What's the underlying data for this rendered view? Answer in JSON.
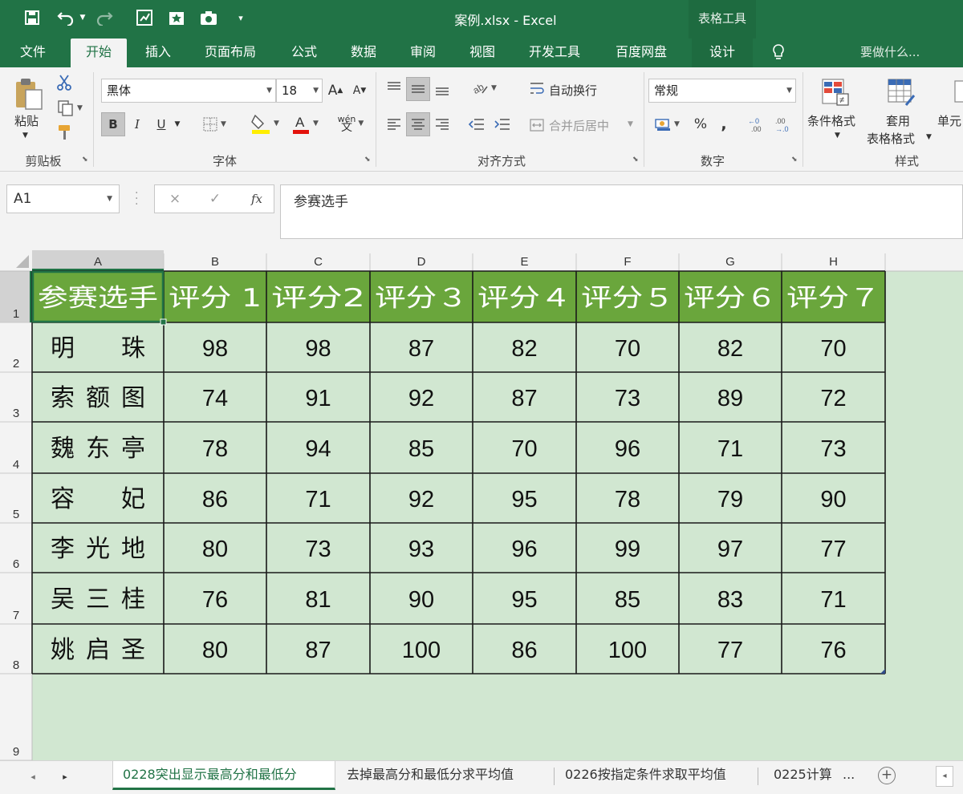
{
  "window": {
    "title": "案例.xlsx - Excel",
    "contextual_title": "表格工具"
  },
  "quick_access": [
    "save-icon",
    "undo-icon",
    "redo-icon",
    "form-icon",
    "star-icon",
    "camera-icon",
    "customize-icon"
  ],
  "ribbon_tabs": [
    {
      "label": "文件"
    },
    {
      "label": "开始"
    },
    {
      "label": "插入"
    },
    {
      "label": "页面布局"
    },
    {
      "label": "公式"
    },
    {
      "label": "数据"
    },
    {
      "label": "审阅"
    },
    {
      "label": "视图"
    },
    {
      "label": "开发工具"
    },
    {
      "label": "百度网盘"
    },
    {
      "label": "设计"
    }
  ],
  "tell_me": "要做什么...",
  "ribbon": {
    "clipboard": {
      "paste_label": "粘贴",
      "group_label": "剪贴板"
    },
    "font": {
      "font_name": "黑体",
      "font_size": "18",
      "bold": "B",
      "italic": "I",
      "underline": "U",
      "group_label": "字体"
    },
    "alignment": {
      "wrap_text": "自动换行",
      "merge_center": "合并后居中",
      "group_label": "对齐方式"
    },
    "number": {
      "format": "常规",
      "percent": "%",
      "comma": ",",
      "group_label": "数字"
    },
    "styles": {
      "conditional": "条件格式",
      "table_format_1": "套用",
      "table_format_2": "表格格式",
      "cell_styles": "单元",
      "group_label": "样式"
    }
  },
  "formula_bar": {
    "name_box": "A1",
    "cancel": "×",
    "enter": "✓",
    "fx": "fx",
    "content": "参赛选手"
  },
  "sheet": {
    "columns": [
      "A",
      "B",
      "C",
      "D",
      "E",
      "F",
      "G",
      "H"
    ],
    "rows": [
      "1",
      "2",
      "3",
      "4",
      "5",
      "6",
      "7",
      "8",
      "9"
    ],
    "header": [
      "参赛选手",
      "评分 1",
      "评分2",
      "评分３",
      "评分４",
      "评分５",
      "评分６",
      "评分７"
    ],
    "data": [
      {
        "name": "明　　珠",
        "scores": [
          "98",
          "98",
          "87",
          "82",
          "70",
          "82",
          "70"
        ]
      },
      {
        "name": "索额图",
        "scores": [
          "74",
          "91",
          "92",
          "87",
          "73",
          "89",
          "72"
        ]
      },
      {
        "name": "魏东亭",
        "scores": [
          "78",
          "94",
          "85",
          "70",
          "96",
          "71",
          "73"
        ]
      },
      {
        "name": "容　　妃",
        "scores": [
          "86",
          "71",
          "92",
          "95",
          "78",
          "79",
          "90"
        ]
      },
      {
        "name": "李光地",
        "scores": [
          "80",
          "73",
          "93",
          "96",
          "99",
          "97",
          "77"
        ]
      },
      {
        "name": "吴三桂",
        "scores": [
          "76",
          "81",
          "90",
          "95",
          "85",
          "83",
          "71"
        ]
      },
      {
        "name": "姚启圣",
        "scores": [
          "80",
          "87",
          "100",
          "86",
          "100",
          "77",
          "76"
        ]
      }
    ]
  },
  "sheet_tabs": [
    {
      "label": "0228突出显示最高分和最低分"
    },
    {
      "label": "去掉最高分和最低分求平均值"
    },
    {
      "label": "0226按指定条件求取平均值"
    },
    {
      "label": "0225计算"
    }
  ],
  "more_tabs": "...",
  "colors": {
    "excel_green": "#217346",
    "header_fill": "#6aa63c",
    "cell_fill": "#d1e7d1",
    "grid_line": "#1a1a1a"
  }
}
